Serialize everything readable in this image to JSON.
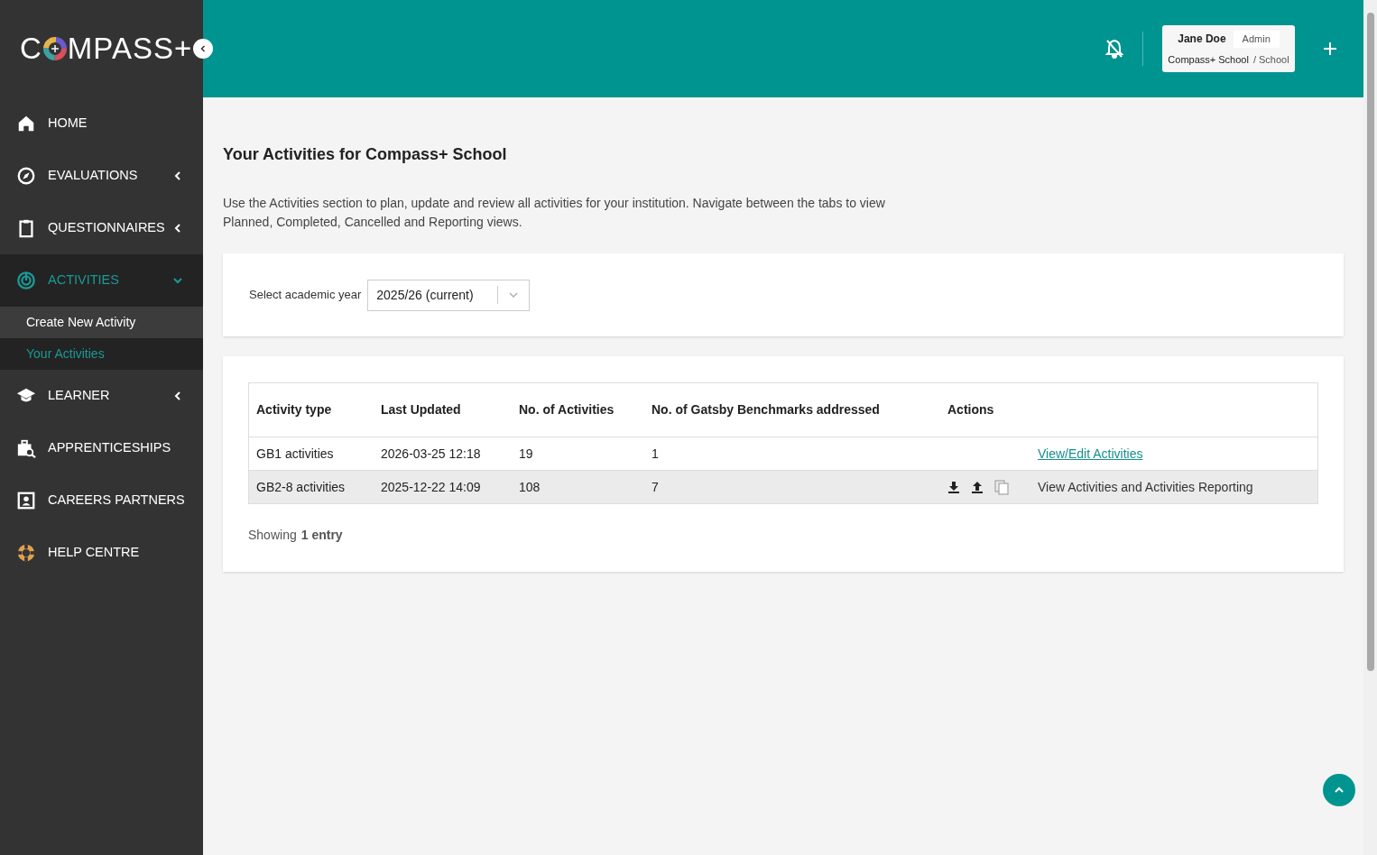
{
  "logo": {
    "before": "C",
    "after": "MPASS+"
  },
  "sidebar": {
    "items": [
      {
        "label": "HOME",
        "active": false
      },
      {
        "label": "EVALUATIONS",
        "expanded": false,
        "active": false
      },
      {
        "label": "QUESTIONNAIRES",
        "expanded": false,
        "active": false
      },
      {
        "label": "ACTIVITIES",
        "expanded": true,
        "active": true,
        "children": [
          {
            "label": "Create New Activity",
            "selected": false
          },
          {
            "label": "Your Activities",
            "selected": true
          }
        ]
      },
      {
        "label": "LEARNER",
        "expanded": false,
        "active": false
      },
      {
        "label": "APPRENTICESHIPS",
        "active": false
      },
      {
        "label": "CAREERS PARTNERS",
        "active": false
      },
      {
        "label": "HELP CENTRE",
        "active": false
      }
    ]
  },
  "header": {
    "user": {
      "name": "Jane Doe",
      "role": "Admin",
      "school": "Compass+ School",
      "school_type": "/ School"
    }
  },
  "page": {
    "title": "Your Activities for Compass+ School",
    "description": "Use the Activities section to plan, update and review all activities for your institution. Navigate between the tabs to view Planned, Completed, Cancelled and Reporting views.",
    "year_select": {
      "label": "Select academic year",
      "value": "2025/26 (current)"
    },
    "table": {
      "columns": [
        "Activity type",
        "Last Updated",
        "No. of Activities",
        "No. of Gatsby Benchmarks addressed",
        "Actions"
      ],
      "rows": [
        {
          "cells": [
            "GB1 activities",
            "2026-03-25 12:18",
            "19",
            "1"
          ],
          "kind": "link",
          "action": "View/Edit Activities",
          "highlighted": false
        },
        {
          "cells": [
            "GB2-8 activities",
            "2025-12-22 14:09",
            "108",
            "7"
          ],
          "kind": "tools",
          "action": "View Activities and Activities Reporting",
          "highlighted": true
        }
      ]
    },
    "footer": {
      "prefix": "Showing",
      "count": "1 entry"
    }
  }
}
